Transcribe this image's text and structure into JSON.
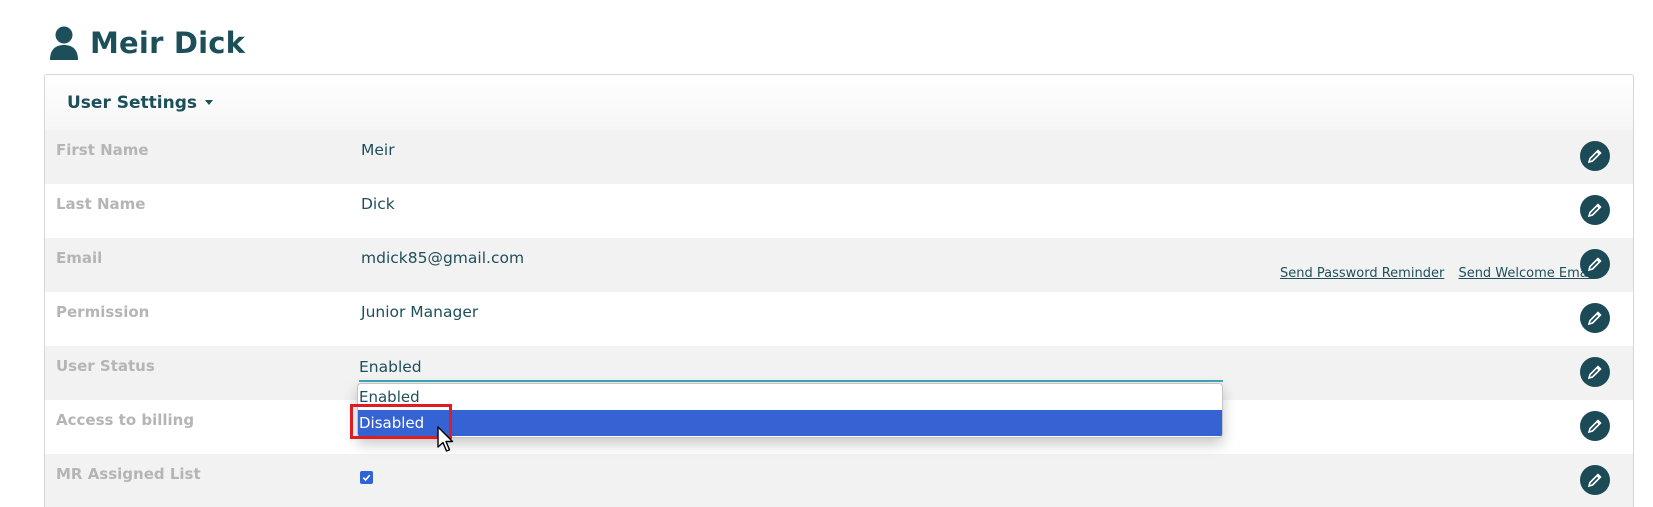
{
  "header": {
    "title": "Meir Dick",
    "icon": "user-icon"
  },
  "panel": {
    "heading": "User Settings"
  },
  "rows": [
    {
      "label": "First Name",
      "value": "Meir"
    },
    {
      "label": "Last Name",
      "value": "Dick"
    },
    {
      "label": "Email",
      "value": "mdick85@gmail.com"
    },
    {
      "label": "Permission",
      "value": "Junior Manager"
    },
    {
      "label": "User Status",
      "value": "Enabled"
    },
    {
      "label": "Access to billing",
      "value": ""
    },
    {
      "label": "MR Assigned List",
      "checked": true
    }
  ],
  "email_links": {
    "password_reminder": "Send Password Reminder",
    "welcome_email": "Send Welcome Email"
  },
  "status_dropdown": {
    "options": [
      "Enabled",
      "Disabled"
    ],
    "highlighted": "Disabled"
  },
  "colors": {
    "accent": "#1c4a57",
    "selection": "#3663d3",
    "highlight_box": "#e01b22"
  }
}
